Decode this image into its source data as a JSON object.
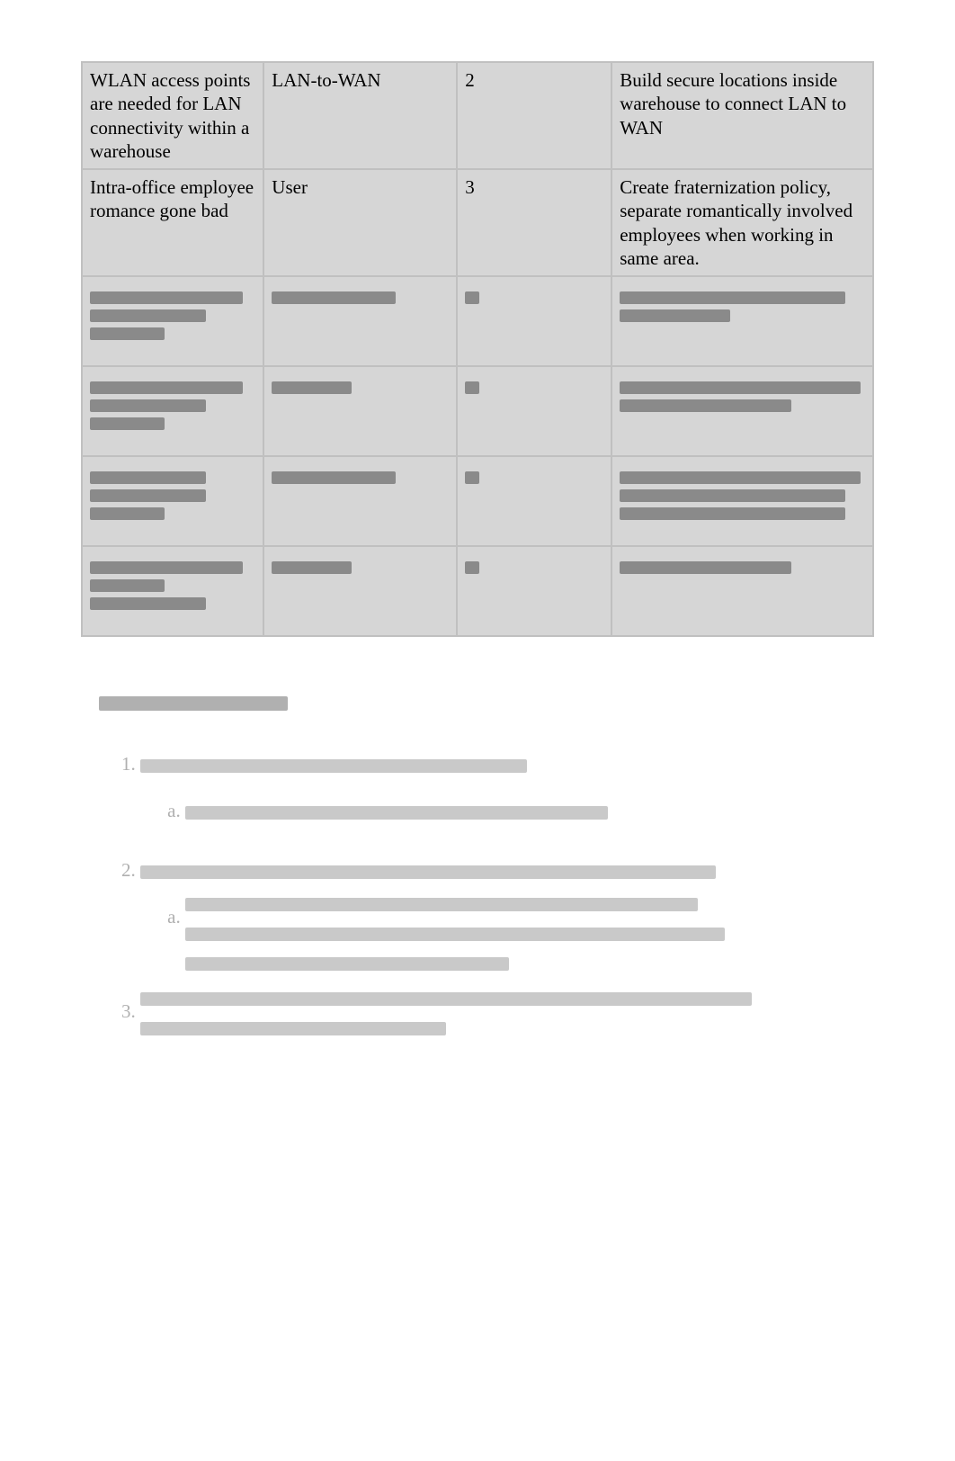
{
  "table": {
    "rows": [
      {
        "risk": "WLAN access points are needed for LAN connectivity within a warehouse",
        "domain": "LAN-to-WAN",
        "impact": "2",
        "mitigation": "Build secure locations inside warehouse to connect LAN to WAN"
      },
      {
        "risk": "Intra-office employee romance gone bad",
        "domain": "User",
        "impact": "3",
        "mitigation": "Create fraternization policy, separate romantically involved employees when working in same area."
      }
    ]
  }
}
